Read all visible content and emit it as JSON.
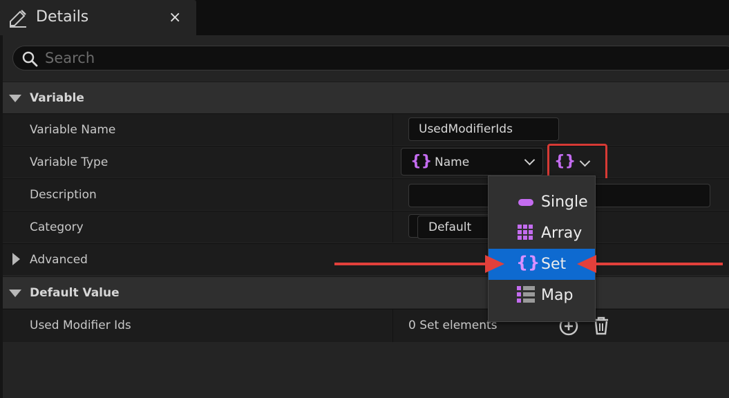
{
  "tab": {
    "title": "Details",
    "close": "×",
    "icon": "edit-pencil-icon"
  },
  "search": {
    "placeholder": "Search",
    "value": ""
  },
  "sections": {
    "variable": {
      "label": "Variable",
      "expanded": true
    },
    "default_value": {
      "label": "Default Value",
      "expanded": true
    }
  },
  "rows": {
    "variable_name": {
      "label": "Variable Name",
      "value": "UsedModifierIds"
    },
    "variable_type": {
      "label": "Variable Type",
      "type_name": "Name",
      "type_icon": "{}"
    },
    "description": {
      "label": "Description",
      "value": ""
    },
    "category": {
      "label": "Category",
      "value": "Default"
    },
    "advanced": {
      "label": "Advanced",
      "expanded": false
    },
    "used_modifier_ids": {
      "label": "Used Modifier Ids",
      "value": "0 Set elements"
    }
  },
  "container_type_button": {
    "icon": "{}"
  },
  "container_menu": {
    "items": [
      {
        "label": "Single",
        "icon": "single-pill-icon",
        "selected": false
      },
      {
        "label": "Array",
        "icon": "array-grid-icon",
        "selected": false
      },
      {
        "label": "Set",
        "icon": "{}",
        "selected": true
      },
      {
        "label": "Map",
        "icon": "map-list-icon",
        "selected": false
      }
    ]
  },
  "colors": {
    "accent_purple": "#c46cf0",
    "selection_blue": "#0e6ad0",
    "annotation_red": "#e2403b"
  }
}
